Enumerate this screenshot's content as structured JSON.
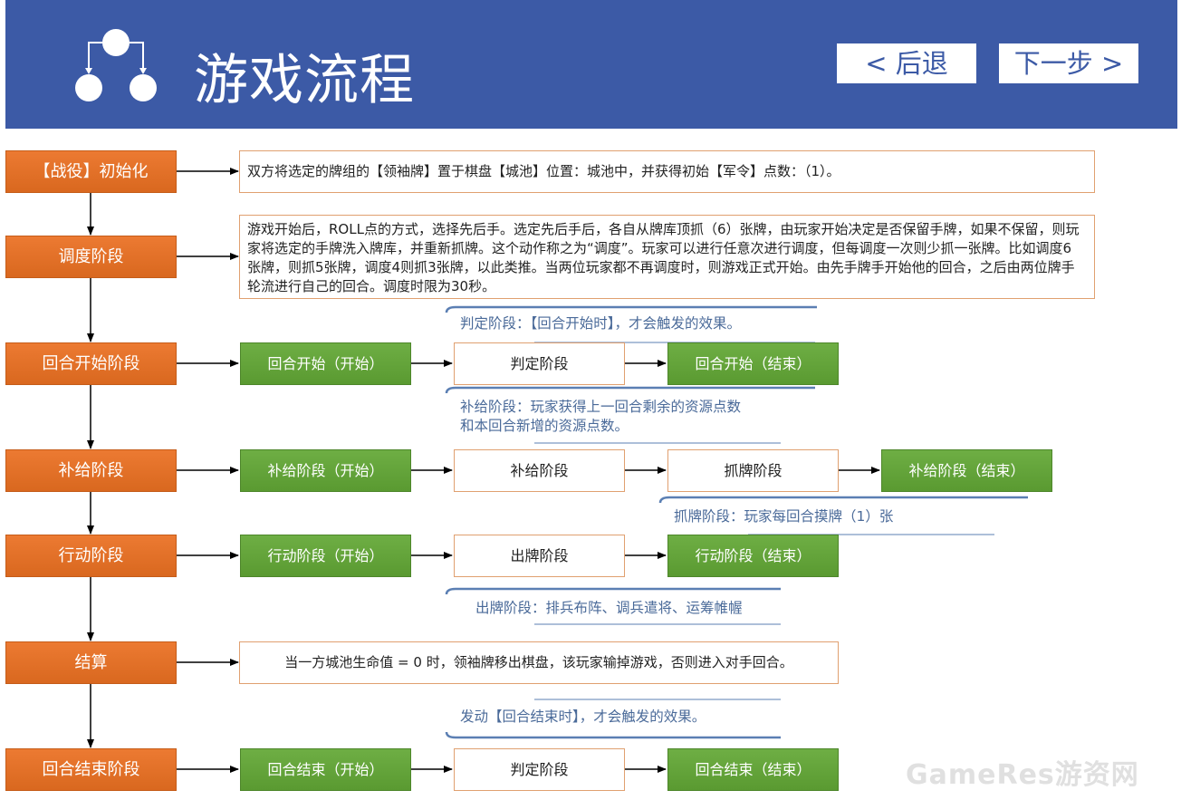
{
  "header": {
    "title": "游戏流程",
    "back_label": "< 后退",
    "next_label": "下一步 >"
  },
  "stages": [
    {
      "label": "【战役】初始化"
    },
    {
      "label": "调度阶段"
    },
    {
      "label": "回合开始阶段"
    },
    {
      "label": "补给阶段"
    },
    {
      "label": "行动阶段"
    },
    {
      "label": "结算"
    },
    {
      "label": "回合结束阶段"
    }
  ],
  "descriptions": {
    "init": "双方将选定的牌组的【领袖牌】置于棋盘【城池】位置：城池中，并获得初始【军令】点数：（1）。",
    "mulligan": "游戏开始后，ROLL点的方式，选择先后手。选定先后手后，各自从牌库顶抓（6）张牌，由玩家开始决定是否保留手牌，如果不保留，则玩家将选定的手牌洗入牌库，并重新抓牌。这个动作称之为“调度”。玩家可以进行任意次进行调度，但每调度一次则少抓一张牌。比如调度6张牌，则抓5张牌，调度4则抓3张牌，以此类推。当两位玩家都不再调度时，则游戏正式开始。由先手牌手开始他的回合，之后由两位牌手轮流进行自己的回合。调度时限为30秒。",
    "settle": "当一方城池生命值 = 0 时，领袖牌移出棋盘，该玩家输掉游戏，否则进入对手回合。"
  },
  "rows": {
    "turn_start": {
      "start": "回合开始（开始）",
      "mid": "判定阶段",
      "end": "回合开始（结束）"
    },
    "supply": {
      "start": "补给阶段（开始）",
      "mid": "补给阶段",
      "mid2": "抓牌阶段",
      "end": "补给阶段（结束）"
    },
    "action": {
      "start": "行动阶段（开始）",
      "mid": "出牌阶段",
      "end": "行动阶段（结束）"
    },
    "turn_end": {
      "start": "回合结束（开始）",
      "mid": "判定阶段",
      "end": "回合结束（结束）"
    }
  },
  "notes": {
    "judge": "判定阶段：【回合开始时】，才会触发的效果。",
    "supply_line1": "补给阶段：玩家获得上一回合剩余的资源点数",
    "supply_line2": "和本回合新增的资源点数。",
    "draw": "抓牌阶段：玩家每回合摸牌（1）张",
    "play": "出牌阶段：排兵布阵、调兵遣将、运筹帷幄",
    "end": "发动【回合结束时】，才会触发的效果。"
  },
  "watermark": "GameRes游资网",
  "colors": {
    "header": "#3c5aa6",
    "stage": "#e0702a",
    "green": "#63a33a",
    "note": "#4a6a99"
  },
  "icon": "flow-diagram-icon"
}
